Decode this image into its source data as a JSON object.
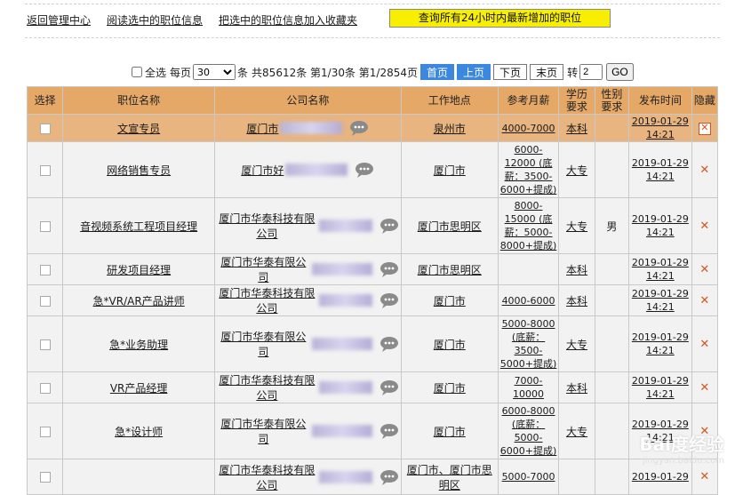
{
  "top_links": [
    "返回管理中心",
    "阅读选中的职位信息",
    "把选中的职位信息加入收藏夹"
  ],
  "query_button": "查询所有24小时内最新增加的职位",
  "pager": {
    "select_all": "全选",
    "per_page_label": "每页",
    "per_page_value": "30",
    "per_page_unit": "条",
    "summary": "共85612条 第1/30条 第1/2854页",
    "first": "首页",
    "prev": "上页",
    "next": "下页",
    "last": "末页",
    "goto_label": "转",
    "goto_value": "2",
    "go": "GO"
  },
  "columns": [
    "选择",
    "职位名称",
    "公司名称",
    "工作地点",
    "参考月薪",
    "学历要求",
    "性别要求",
    "发布时间",
    "隐藏"
  ],
  "rows": [
    {
      "title": "文宣专员",
      "company": "厦门市",
      "location": "泉州市",
      "salary": "4000-7000",
      "edu": "本科",
      "gender": "",
      "time": "2019-01-29 14:21"
    },
    {
      "title": "网络销售专员",
      "company": "厦门市好",
      "location": "厦门市",
      "salary": "6000-12000 (底薪：3500-6000+提成)",
      "edu": "大专",
      "gender": "",
      "time": "2019-01-29 14:21"
    },
    {
      "title": "音视频系统工程项目经理",
      "company": "厦门市华泰科技有限公司",
      "location": "厦门市思明区",
      "salary": "8000-15000 (底薪：5000-8000+提成)",
      "edu": "大专",
      "gender": "男",
      "time": "2019-01-29 14:21"
    },
    {
      "title": "研发项目经理",
      "company": "厦门市华泰有限公司",
      "location": "厦门市思明区",
      "salary": "",
      "edu": "本科",
      "gender": "",
      "time": "2019-01-29 14:21"
    },
    {
      "title": "急*VR/AR产品讲师",
      "company": "厦门市华泰科技有限公司",
      "location": "厦门市",
      "salary": "4000-6000",
      "edu": "本科",
      "gender": "",
      "time": "2019-01-29 14:21"
    },
    {
      "title": "急*业务助理",
      "company": "厦门市华泰有限公司",
      "location": "厦门市",
      "salary": "5000-8000 (底薪：3500-5000+提成)",
      "edu": "大专",
      "gender": "",
      "time": "2019-01-29 14:21"
    },
    {
      "title": "VR产品经理",
      "company": "厦门市华泰科技有限公司",
      "location": "厦门市",
      "salary": "7000-10000",
      "edu": "本科",
      "gender": "",
      "time": "2019-01-29 14:21"
    },
    {
      "title": "急*设计师",
      "company": "厦门市华泰有限公司",
      "location": "厦门市",
      "salary": "6000-8000 (底薪：5000-6000+提成)",
      "edu": "大专",
      "gender": "",
      "time": "2019-01-29 14:21"
    },
    {
      "title": "",
      "company": "厦门市华泰科技有限公司",
      "location": "厦门市、厦门市思明区",
      "salary": "5000-7000",
      "edu": "",
      "gender": "",
      "time": "2019-01-29"
    }
  ],
  "watermark": {
    "main": "Bai度经验",
    "sub": "jingyan.baidu.com"
  },
  "colors": {
    "header_bg": "#e5a866",
    "highlight_row": "#e8b47f",
    "accent_blue": "#3b88de",
    "query_yellow": "#f7ee00",
    "hide_x": "#d9531e"
  }
}
